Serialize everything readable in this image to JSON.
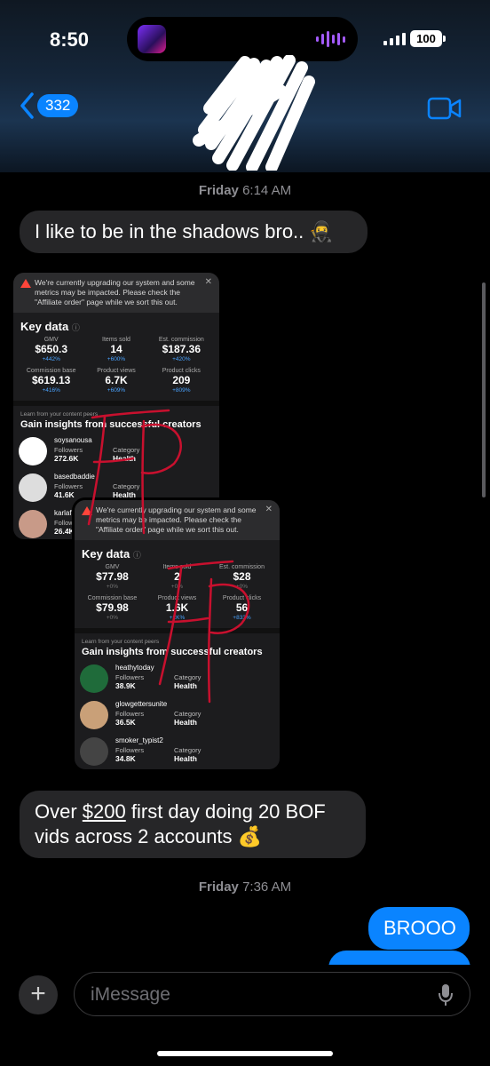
{
  "status_bar": {
    "time": "8:50",
    "battery": "100"
  },
  "header": {
    "back_count": "332"
  },
  "messages": {
    "timestamp_1_day": "Friday",
    "timestamp_1_time": "6:14 AM",
    "msg_1": "I like to be in the shadows bro.. 🥷",
    "msg_2_prefix": "Over ",
    "msg_2_amount": "$200",
    "msg_2_rest": " first day doing 20 BOF vids across 2 accounts 💰",
    "timestamp_2_day": "Friday",
    "timestamp_2_time": "7:36 AM",
    "msg_3": "BROOO"
  },
  "card1": {
    "warning": "We're currently upgrading our system and some metrics may be impacted. Please check the \"Affiliate order\" page while we sort this out.",
    "key_title": "Key data",
    "metrics": [
      {
        "label": "GMV",
        "value": "$650.3",
        "change": "+442%"
      },
      {
        "label": "Items sold",
        "value": "14",
        "change": "+600%"
      },
      {
        "label": "Est. commission",
        "value": "$187.36",
        "change": "+420%"
      },
      {
        "label": "Commission base",
        "value": "$619.13",
        "change": "+416%"
      },
      {
        "label": "Product views",
        "value": "6.7K",
        "change": "+609%"
      },
      {
        "label": "Product clicks",
        "value": "209",
        "change": "+809%"
      }
    ],
    "learn": "Learn from your content peers",
    "gain": "Gain insights from successful creators",
    "creators": [
      {
        "name": "soysanousa",
        "followers_label": "Followers",
        "followers": "272.6K",
        "category_label": "Category",
        "category": "Health"
      },
      {
        "name": "basedbaddie",
        "followers_label": "Followers",
        "followers": "41.6K",
        "category_label": "Category",
        "category": "Health"
      },
      {
        "name": "karlafr",
        "followers_label": "Followers",
        "followers": "26.4K",
        "category_label": "",
        "category": ""
      }
    ]
  },
  "card2": {
    "warning": "We're currently upgrading our system and some metrics may be impacted. Please check the \"Affiliate order\" page while we sort this out.",
    "key_title": "Key data",
    "metrics": [
      {
        "label": "GMV",
        "value": "$77.98",
        "change": "+0%"
      },
      {
        "label": "Items sold",
        "value": "2",
        "change": "+0%"
      },
      {
        "label": "Est. commission",
        "value": "$28",
        "change": "+0%"
      },
      {
        "label": "Commission base",
        "value": "$79.98",
        "change": "+0%"
      },
      {
        "label": "Product views",
        "value": "1.6K",
        "change": "+2K%"
      },
      {
        "label": "Product clicks",
        "value": "56",
        "change": "+833%"
      }
    ],
    "learn": "Learn from your content peers",
    "gain": "Gain insights from successful creators",
    "creators": [
      {
        "name": "heathytoday",
        "followers_label": "Followers",
        "followers": "38.9K",
        "category_label": "Category",
        "category": "Health"
      },
      {
        "name": "glowgettersunite",
        "followers_label": "Followers",
        "followers": "36.5K",
        "category_label": "Category",
        "category": "Health"
      },
      {
        "name": "smoker_typist2",
        "followers_label": "Followers",
        "followers": "34.8K",
        "category_label": "Category",
        "category": "Health"
      }
    ]
  },
  "input": {
    "placeholder": "iMessage"
  },
  "colors": {
    "imessage_blue": "#0a84ff",
    "incoming_bubble": "#262628",
    "annotation_red": "#c8102e"
  }
}
